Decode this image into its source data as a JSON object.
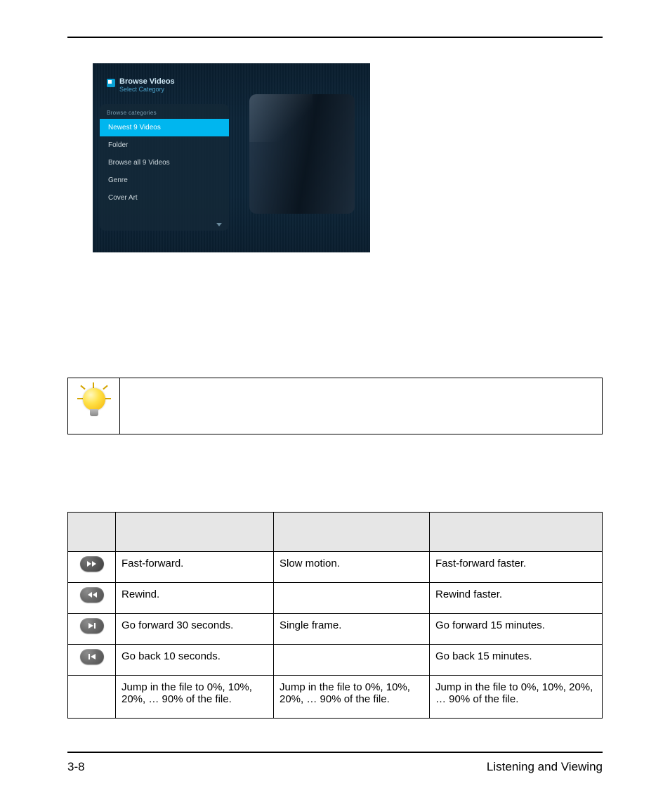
{
  "screenshot": {
    "title": "Browse Videos",
    "subtitle": "Select Category",
    "panel_header": "Browse categories",
    "items": [
      "Newest 9 Videos",
      "Folder",
      "Browse all 9 Videos",
      "Genre",
      "Cover Art"
    ],
    "selected_index": 0
  },
  "controls": {
    "headers": [
      "",
      "",
      "",
      ""
    ],
    "rows": [
      {
        "icon": "fast-forward",
        "a": "Fast-forward.",
        "b": "Slow motion.",
        "c": "Fast-forward faster."
      },
      {
        "icon": "rewind",
        "a": "Rewind.",
        "b": "",
        "c": "Rewind faster."
      },
      {
        "icon": "skip-forward",
        "a": "Go forward 30 seconds.",
        "b": "Single frame.",
        "c": "Go forward 15 minutes."
      },
      {
        "icon": "skip-back",
        "a": "Go back 10 seconds.",
        "b": "",
        "c": "Go back 15 minutes."
      },
      {
        "icon": "",
        "a": "Jump in the file to 0%, 10%, 20%, … 90% of the file.",
        "b": "Jump in the file to 0%, 10%, 20%, … 90% of the file.",
        "c": "Jump in the file to 0%, 10%, 20%, … 90% of the file."
      }
    ]
  },
  "footer": {
    "page": "3-8",
    "section": "Listening and Viewing"
  }
}
